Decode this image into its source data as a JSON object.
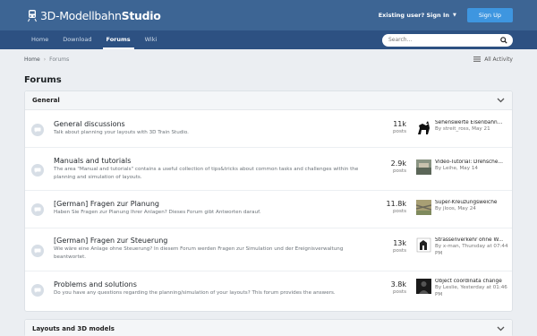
{
  "header": {
    "logo_prefix": "3D-Modellbahn",
    "logo_bold": "Studio",
    "signin": "Existing user? Sign In",
    "signup": "Sign Up"
  },
  "nav": {
    "items": [
      "Home",
      "Download",
      "Forums",
      "Wiki"
    ],
    "active": "Forums",
    "search_placeholder": "Search..."
  },
  "breadcrumb": {
    "home": "Home",
    "current": "Forums"
  },
  "all_activity": "All Activity",
  "page_title": "Forums",
  "section_general": {
    "title": "General",
    "forums": [
      {
        "title": "General discussions",
        "desc": "Talk about planning your layouts with 3D Train Studio.",
        "posts": "11k",
        "posts_label": "posts",
        "last_title": "Sehenswerte Eisenbahn...",
        "last_meta": "By streit_ross, May 21"
      },
      {
        "title": "Manuals and tutorials",
        "desc": "The area \"Manual and tutorials\" contains a useful collection of tips&tricks about common tasks and challenges within the planning and simulation of layouts.",
        "posts": "2.9k",
        "posts_label": "posts",
        "last_title": "Video-Tutorial: Drehsche...",
        "last_meta": "By Leihe, May 14"
      },
      {
        "title": "[German] Fragen zur Planung",
        "desc": "Haben Sie Fragen zur Planung Ihrer Anlagen? Dieses Forum gibt Antworten darauf.",
        "posts": "11.8k",
        "posts_label": "posts",
        "last_title": "Super-Kreuzungsweiche",
        "last_meta": "By jloos, May 24"
      },
      {
        "title": "[German] Fragen zur Steuerung",
        "desc": "Wie wäre eine Anlage ohne Steuerung? In diesem Forum werden Fragen zur Simulation und der Ereignisverwaltung beantwortet.",
        "posts": "13k",
        "posts_label": "posts",
        "last_title": "Strassenverkehr ohne W...",
        "last_meta": "By x-man, Thursday at 07:44 PM"
      },
      {
        "title": "Problems and solutions",
        "desc": "Do you have any questions regarding the planning/simulation of your layouts? This forum provides the answers.",
        "posts": "3.8k",
        "posts_label": "posts",
        "last_title": "Object coordinata change",
        "last_meta": "By Leslie, Yesterday at 01:46 PM"
      }
    ]
  },
  "section_layouts": {
    "title": "Layouts and 3D models"
  },
  "colors": {
    "header": "#3d6594",
    "navbar": "#2d5182",
    "accent": "#3e96e0",
    "background": "#ebeef2"
  }
}
